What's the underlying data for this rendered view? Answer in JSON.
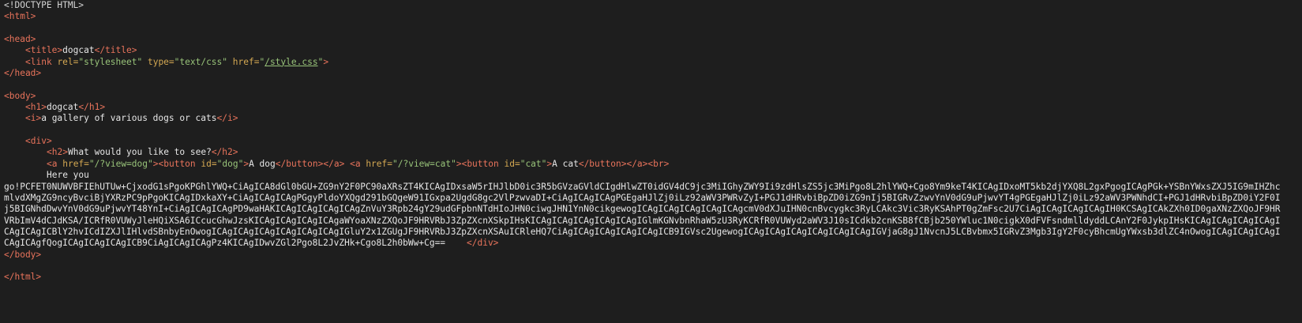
{
  "source": {
    "doctype": "<!DOCTYPE HTML>",
    "html_open": "<html>",
    "head_open": "<head>",
    "title_open": "<title>",
    "title_text": "dogcat",
    "title_close": "</title>",
    "link_open": "<link",
    "rel_attr": "rel=",
    "rel_val": "\"stylesheet\"",
    "type_attr": "type=",
    "type_val": "\"text/css\"",
    "href_attr": "href=",
    "href_q1": "\"",
    "href_link": "/style.css",
    "href_q2": "\"",
    "link_close": ">",
    "head_close": "</head>",
    "body_open": "<body>",
    "h1_open": "<h1>",
    "h1_text": "dogcat",
    "h1_close": "</h1>",
    "i_open": "<i>",
    "i_text": "a gallery of various dogs or cats",
    "i_close": "</i>",
    "div_open": "<div>",
    "h2_open": "<h2>",
    "h2_text": "What would you like to see?",
    "h2_close": "</h2>",
    "a1_open": "<a",
    "a1_href_attr": "href=",
    "a1_href_val": "\"/?view=dog\"",
    "a1_gt": ">",
    "btn1_open": "<button",
    "btn1_id_attr": "id=",
    "btn1_id_val": "\"dog\"",
    "btn1_gt": ">",
    "btn1_text": "A dog",
    "btn1_close": "</button>",
    "a1_close": "</a>",
    "a2_open": "<a",
    "a2_href_attr": "href=",
    "a2_href_val": "\"/?view=cat\"",
    "a2_gt": ">",
    "btn2_open": "<button",
    "btn2_id_attr": "id=",
    "btn2_id_val": "\"cat\"",
    "btn2_gt": ">",
    "btn2_text": "A cat",
    "btn2_close": "</button>",
    "a2_close": "</a>",
    "br": "<br>",
    "here_you": "Here you",
    "payload": "go!PCFET0NUWVBFIEhUTUw+CjxodG1sPgoKPGhlYWQ+CiAgICA8dGl0bGU+ZG9nY2F0PC90aXRsZT4KICAgIDxsaW5rIHJlbD0ic3R5bGVzaGVldCIgdHlwZT0idGV4dC9jc3MiIGhyZWY9Ii9zdHlsZS5jc3MiPgo8L2hlYWQ+Cgo8Ym9keT4KICAgIDxoMT5kb2djYXQ8L2gxPgogICAgPGk+YSBnYWxsZXJ5IG9mIHZhcmlvdXMgZG9ncyBvciBjYXRzPC9pPgoKICAgIDxkaXY+CiAgICAgICAgPGgyPldoYXQgd291bGQgeW91IGxpa2UgdG8gc2VlPzwvaDI+CiAgICAgICAgPGEgaHJlZj0iLz92aWV3PWRvZyI+PGJ1dHRvbiBpZD0iZG9nIj5BIGRvZzwvYnV0dG9uPjwvYT4gPGEgaHJlZj0iLz92aWV3PWNhdCI+PGJ1dHRvbiBpZD0iY2F0Ij5BIGNhdDwvYnV0dG9uPjwvYT48YnI+CiAgICAgICAgPD9waHAKICAgICAgICAgICAgZnVuY3Rpb24gY29udGFpbnNTdHIoJHN0ciwgJHN1YnN0cikgewogICAgICAgICAgICAgICAgcmV0dXJuIHN0cnBvcygkc3RyLCAkc3Vic3RyKSAhPT0gZmFsc2U7CiAgICAgICAgICAgIH0KCSAgICAkZXh0ID0gaXNzZXQoJF9HRVRbImV4dCJdKSA/ICRfR0VUWyJleHQiXSA6ICcucGhwJzsKICAgICAgICAgICAgaWYoaXNzZXQoJF9HRVRbJ3ZpZXcnXSkpIHsKICAgICAgICAgICAgICAgIGlmKGNvbnRhaW5zU3RyKCRfR0VUWyd2aWV3J10sICdkb2cnKSB8fCBjb250YWluc1N0cigkX0dFVFsndmlldyddLCAnY2F0JykpIHsKICAgICAgICAgICAgICAgICAgICBlY2hvICdIZXJlIHlvdSBnbyEnOwogICAgICAgICAgICAgICAgICAgIGluY2x1ZGUgJF9HRVRbJ3ZpZXcnXSAuICRleHQ7CiAgICAgICAgICAgICAgICB9IGVsc2UgewogICAgICAgICAgICAgICAgICAgIGVjaG8gJ1NvcnJ5LCBvbmx5IGRvZ3Mgb3IgY2F0cyBhcmUgYWxsb3dlZC4nOwogICAgICAgICAgICAgICAgfQogICAgICAgICAgICB9CiAgICAgICAgPz4KICAgIDwvZGl2Pgo8L2JvZHk+Cgo8L2h0bWw+Cg==",
    "div_close": "</div>",
    "body_close": "</body>",
    "html_close": "</html>"
  }
}
